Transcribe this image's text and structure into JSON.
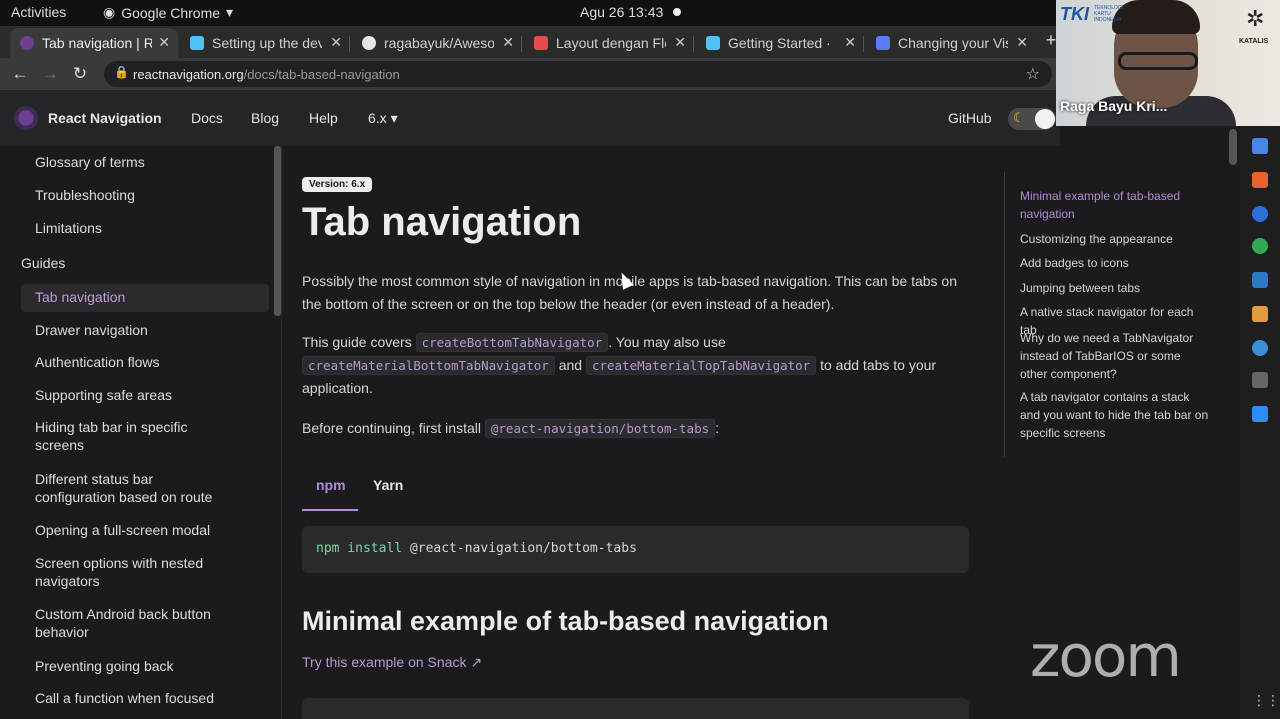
{
  "os": {
    "activities": "Activities",
    "app_menu": "Google Chrome",
    "clock": "Agu 26  13:43"
  },
  "tabs": [
    {
      "title": "Tab navigation | R",
      "favicon_color": "#6c3f8f"
    },
    {
      "title": "Setting up the dev",
      "favicon_color": "#4fc3f7"
    },
    {
      "title": "ragabayuk/Aweso",
      "favicon_color": "#e6e6e6"
    },
    {
      "title": "Layout dengan Fle",
      "favicon_color": "#e84b4b"
    },
    {
      "title": "Getting Started ·",
      "favicon_color": "#4fc3f7"
    },
    {
      "title": "Changing your Vis",
      "favicon_color": "#5b7cfa"
    }
  ],
  "address": {
    "domain": "reactnavigation.org",
    "path": "/docs/tab-based-navigation"
  },
  "site": {
    "brand": "React Navigation",
    "links": [
      "Docs",
      "Blog",
      "Help"
    ],
    "version": "6.x",
    "github": "GitHub"
  },
  "sidebar": {
    "items_top": [
      "Glossary of terms",
      "Troubleshooting",
      "Limitations"
    ],
    "category": "Guides",
    "items": [
      "Tab navigation",
      "Drawer navigation",
      "Authentication flows",
      "Supporting safe areas",
      "Hiding tab bar in specific screens",
      "Different status bar configuration based on route",
      "Opening a full-screen modal",
      "Screen options with nested navigators",
      "Custom Android back button behavior",
      "Preventing going back",
      "Call a function when focused"
    ]
  },
  "main": {
    "badge": "Version: 6.x",
    "title": "Tab navigation",
    "intro": "Possibly the most common style of navigation in mobile apps is tab-based navigation. This can be tabs on the bottom of the screen or on the top below the header (or even instead of a header).",
    "covers_prefix": "This guide covers",
    "covers_code1": "createBottomTabNavigator",
    "covers_mid": ". You may also use",
    "covers_code2": "createMaterialBottomTabNavigator",
    "covers_and": "and",
    "covers_code3": "createMaterialTopTabNavigator",
    "covers_suffix": "to add tabs to your application.",
    "install_prefix": "Before continuing, first install",
    "install_code": "@react-navigation/bottom-tabs",
    "install_suffix": ":",
    "pkg_tabs": [
      "npm",
      "Yarn"
    ],
    "cmd_keyword": "npm install",
    "cmd_arg": "@react-navigation/bottom-tabs",
    "h2": "Minimal example of tab-based navigation",
    "snack": "Try this example on Snack"
  },
  "toc": [
    "Minimal example of tab-based navigation",
    "Customizing the appearance",
    "Add badges to icons",
    "Jumping between tabs",
    "A native stack navigator for each tab",
    "Why do we need a TabNavigator instead of TabBarIOS or some other component?",
    "A tab navigator contains a stack and you want to hide the tab bar on specific screens"
  ],
  "video": {
    "participant": "Raga Bayu Kri...",
    "logo_left": "TKI",
    "logo_left_sub": "TEKNOLOGI KARTU INDONESIA",
    "logo_right": "KATALIS",
    "watermark": "zoom"
  },
  "colors": {
    "accent": "#b08dd8",
    "background": "#1b1b1d",
    "navbar": "#242526"
  }
}
